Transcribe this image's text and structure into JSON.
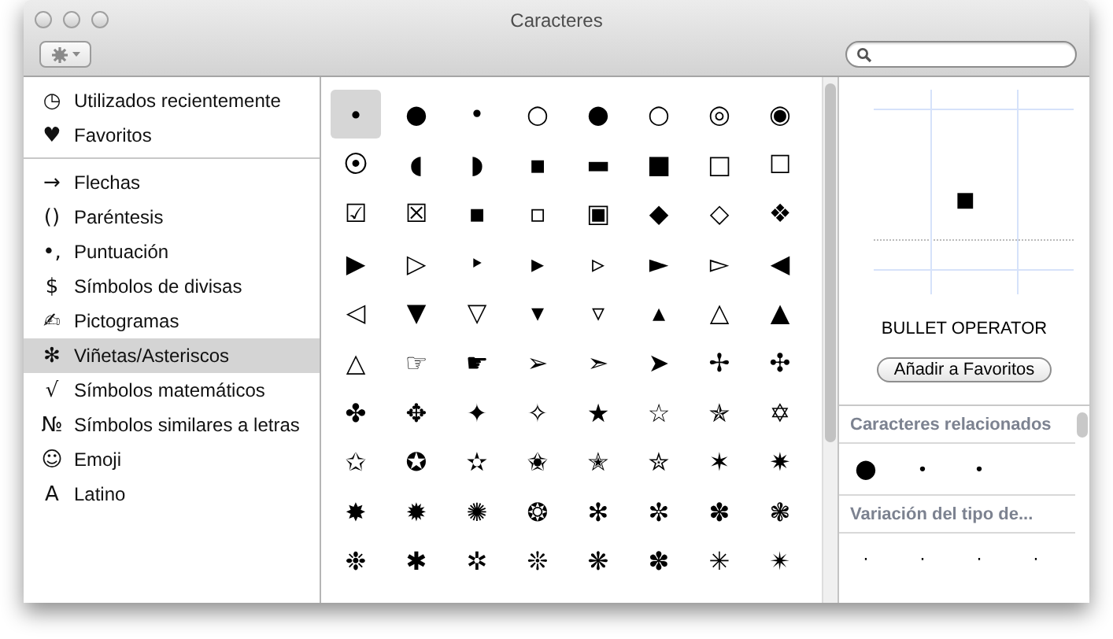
{
  "window": {
    "title": "Caracteres"
  },
  "sidebar": {
    "groups": [
      [
        {
          "icon": "◷",
          "label": "Utilizados recientemente",
          "selected": false
        },
        {
          "icon": "♥",
          "label": "Favoritos",
          "selected": false
        }
      ],
      [
        {
          "icon": "→",
          "label": "Flechas",
          "selected": false
        },
        {
          "icon": "()",
          "label": "Paréntesis",
          "selected": false
        },
        {
          "icon": "•,",
          "label": "Puntuación",
          "selected": false
        },
        {
          "icon": "$",
          "label": "Símbolos de divisas",
          "selected": false
        },
        {
          "icon": "✍",
          "label": "Pictogramas",
          "selected": false
        },
        {
          "icon": "✻",
          "label": "Viñetas/Asteriscos",
          "selected": true
        },
        {
          "icon": "√",
          "label": "Símbolos matemáticos",
          "selected": false
        },
        {
          "icon": "№",
          "label": "Símbolos similares a letras",
          "selected": false
        },
        {
          "icon": "☺",
          "label": "Emoji",
          "selected": false
        },
        {
          "icon": "A",
          "label": "Latino",
          "selected": false
        }
      ]
    ]
  },
  "grid": {
    "cells": [
      {
        "char": "∙",
        "selected": true
      },
      {
        "char": "●",
        "selected": false
      },
      {
        "char": "•",
        "selected": false
      },
      {
        "char": "○",
        "selected": false
      },
      {
        "char": "●",
        "selected": false
      },
      {
        "char": "○",
        "selected": false
      },
      {
        "char": "◎",
        "selected": false
      },
      {
        "char": "◉",
        "selected": false
      },
      {
        "char": "⦿",
        "selected": false
      },
      {
        "char": "◖",
        "selected": false
      },
      {
        "char": "◗",
        "selected": false
      },
      {
        "char": "▪",
        "selected": false
      },
      {
        "char": "▬",
        "selected": false
      },
      {
        "char": "■",
        "selected": false
      },
      {
        "char": "□",
        "selected": false
      },
      {
        "char": "☐",
        "selected": false
      },
      {
        "char": "☑",
        "selected": false
      },
      {
        "char": "☒",
        "selected": false
      },
      {
        "char": "▪",
        "selected": false
      },
      {
        "char": "▫",
        "selected": false
      },
      {
        "char": "▣",
        "selected": false
      },
      {
        "char": "◆",
        "selected": false
      },
      {
        "char": "◇",
        "selected": false
      },
      {
        "char": "❖",
        "selected": false
      },
      {
        "char": "▶",
        "selected": false
      },
      {
        "char": "▷",
        "selected": false
      },
      {
        "char": "‣",
        "selected": false
      },
      {
        "char": "▸",
        "selected": false
      },
      {
        "char": "▹",
        "selected": false
      },
      {
        "char": "►",
        "selected": false
      },
      {
        "char": "▻",
        "selected": false
      },
      {
        "char": "◀",
        "selected": false
      },
      {
        "char": "◁",
        "selected": false
      },
      {
        "char": "▼",
        "selected": false
      },
      {
        "char": "▽",
        "selected": false
      },
      {
        "char": "▾",
        "selected": false
      },
      {
        "char": "▿",
        "selected": false
      },
      {
        "char": "▴",
        "selected": false
      },
      {
        "char": "△",
        "selected": false
      },
      {
        "char": "▲",
        "selected": false
      },
      {
        "char": "△",
        "selected": false
      },
      {
        "char": "☞",
        "selected": false
      },
      {
        "char": "☛",
        "selected": false
      },
      {
        "char": "➢",
        "selected": false
      },
      {
        "char": "➣",
        "selected": false
      },
      {
        "char": "➤",
        "selected": false
      },
      {
        "char": "✢",
        "selected": false
      },
      {
        "char": "✣",
        "selected": false
      },
      {
        "char": "✤",
        "selected": false
      },
      {
        "char": "✥",
        "selected": false
      },
      {
        "char": "✦",
        "selected": false
      },
      {
        "char": "✧",
        "selected": false
      },
      {
        "char": "★",
        "selected": false
      },
      {
        "char": "☆",
        "selected": false
      },
      {
        "char": "✯",
        "selected": false
      },
      {
        "char": "✡",
        "selected": false
      },
      {
        "char": "✩",
        "selected": false
      },
      {
        "char": "✪",
        "selected": false
      },
      {
        "char": "✫",
        "selected": false
      },
      {
        "char": "✬",
        "selected": false
      },
      {
        "char": "✭",
        "selected": false
      },
      {
        "char": "✮",
        "selected": false
      },
      {
        "char": "✶",
        "selected": false
      },
      {
        "char": "✷",
        "selected": false
      },
      {
        "char": "✸",
        "selected": false
      },
      {
        "char": "✹",
        "selected": false
      },
      {
        "char": "✺",
        "selected": false
      },
      {
        "char": "❂",
        "selected": false
      },
      {
        "char": "✻",
        "selected": false
      },
      {
        "char": "✼",
        "selected": false
      },
      {
        "char": "✽",
        "selected": false
      },
      {
        "char": "❃",
        "selected": false
      },
      {
        "char": "❉",
        "selected": false
      },
      {
        "char": "✱",
        "selected": false
      },
      {
        "char": "✲",
        "selected": false
      },
      {
        "char": "❊",
        "selected": false
      },
      {
        "char": "❋",
        "selected": false
      },
      {
        "char": "✽",
        "selected": false
      },
      {
        "char": "✳",
        "selected": false
      },
      {
        "char": "✴",
        "selected": false
      }
    ]
  },
  "preview": {
    "char": "■",
    "name": "BULLET OPERATOR",
    "button": "Añadir a Favoritos"
  },
  "related": {
    "title": "Caracteres relacionados",
    "chars": [
      "●",
      "•",
      "•"
    ]
  },
  "variation": {
    "title": "Variación del tipo de...",
    "chars": [
      "·",
      "·",
      "·",
      "·"
    ]
  }
}
